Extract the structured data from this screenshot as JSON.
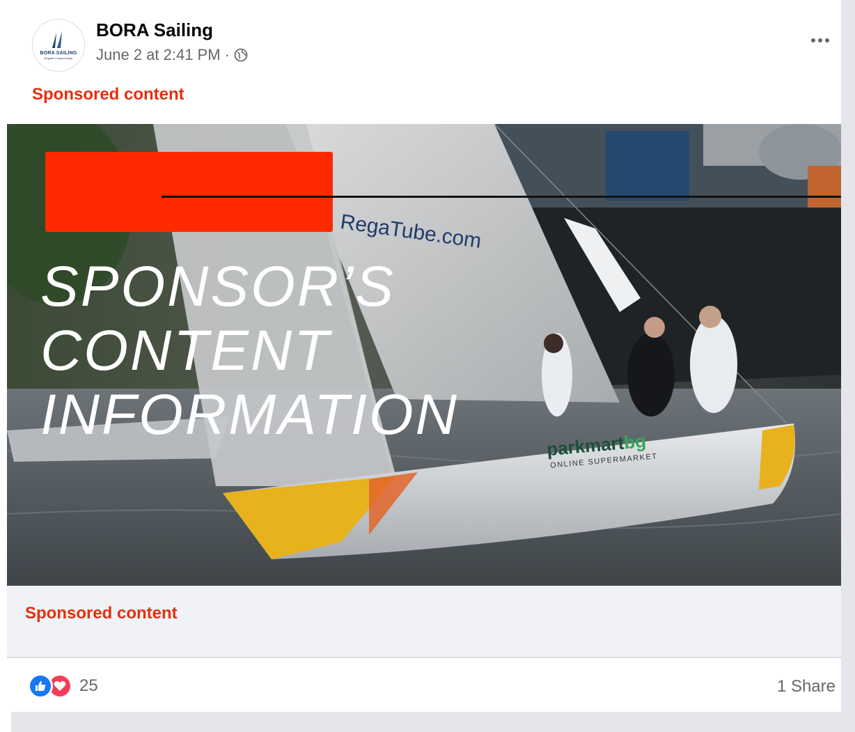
{
  "post": {
    "page_name": "BORA Sailing",
    "timestamp": "June 2 at 2:41 PM",
    "separator": "·",
    "avatar_logo_text": "BORA SAILING",
    "avatar_logo_subtext": "Regatta Championship",
    "sponsored_label_top": "Sponsored content",
    "sponsored_label_bottom": "Sponsored content"
  },
  "image": {
    "overlay_lines": [
      "SPONSOR’S",
      "CONTENT",
      "INFORMATION"
    ],
    "sail_text": "RegaTube.com",
    "boat_brand": "parkmart",
    "boat_brand_suffix": "bg",
    "boat_subtitle": "ONLINE SUPERMARKET",
    "redaction_color": "#ff2a00"
  },
  "footer": {
    "reaction_count": "25",
    "share_text": "1 Share"
  },
  "icons": {
    "more": "more-horizontal-icon",
    "globe": "globe-icon",
    "like": "like-reaction-icon",
    "love": "love-reaction-icon"
  },
  "colors": {
    "sponsored": "#e4300e",
    "like_blue": "#1877f2",
    "love_red": "#f33e58",
    "meta_grey": "#65676b"
  }
}
